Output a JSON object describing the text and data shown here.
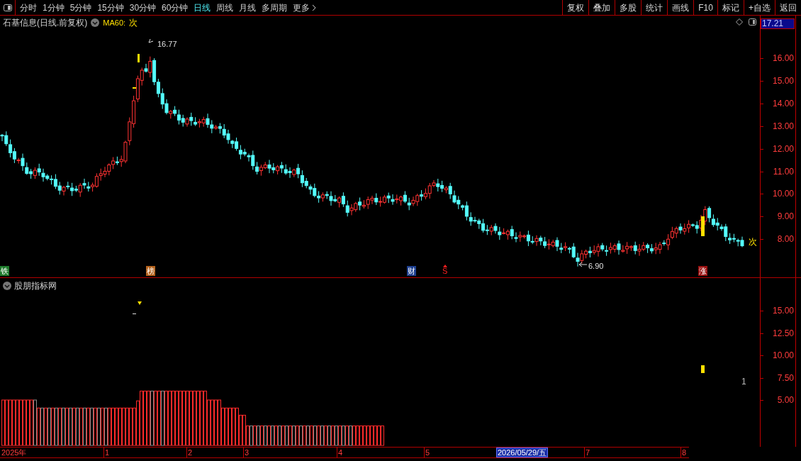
{
  "toolbar": {
    "periods": [
      {
        "label": "分时",
        "selected": false
      },
      {
        "label": "1分钟",
        "selected": false
      },
      {
        "label": "5分钟",
        "selected": false
      },
      {
        "label": "15分钟",
        "selected": false
      },
      {
        "label": "30分钟",
        "selected": false
      },
      {
        "label": "60分钟",
        "selected": false
      },
      {
        "label": "日线",
        "selected": true
      },
      {
        "label": "周线",
        "selected": false
      },
      {
        "label": "月线",
        "selected": false
      },
      {
        "label": "多周期",
        "selected": false
      }
    ],
    "more": "更多",
    "buttons": [
      "复权",
      "叠加",
      "多股",
      "统计",
      "画线",
      "F10",
      "标记",
      "+自选",
      "返回"
    ]
  },
  "price_panel": {
    "title": "石基信息(日线.前复权)",
    "indicator": "MA60:",
    "indicator_value": "次",
    "current_price": "17.21",
    "yticks": [
      "16.00",
      "15.00",
      "14.00",
      "13.00",
      "12.00",
      "11.00",
      "10.00",
      "9.00",
      "8.00"
    ],
    "high_label": "16.77",
    "low_label": "6.90",
    "signal_label": "次",
    "events": [
      {
        "label": "铁",
        "kind": "badge",
        "color": "#1e7a2c"
      },
      {
        "label": "榜",
        "kind": "badge",
        "color": "#b4621c"
      },
      {
        "label": "财",
        "kind": "badge",
        "color": "#1d3f8f"
      },
      {
        "label": "S",
        "kind": "arrow",
        "color": "#ff2020"
      },
      {
        "label": "涨",
        "kind": "badge",
        "color": "#9a1010"
      }
    ]
  },
  "indicator_panel": {
    "title": "股朋指标网",
    "yticks": [
      "15.00",
      "12.50",
      "10.00",
      "7.50",
      "5.00"
    ],
    "value_label": "1"
  },
  "date_axis": {
    "labels": [
      "2025年",
      "1",
      "2",
      "3",
      "4",
      "5",
      "7",
      "8"
    ],
    "cursor_date": "2026/05/29/五"
  }
}
